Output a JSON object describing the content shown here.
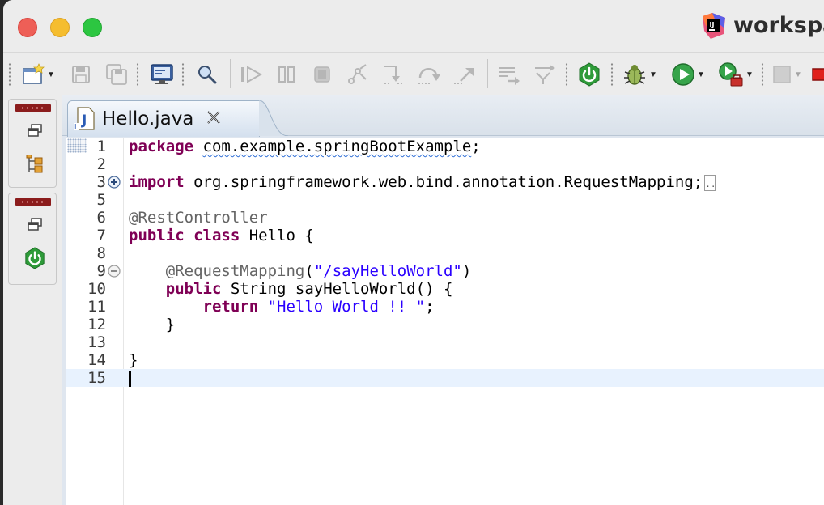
{
  "window": {
    "app_title": "workspace",
    "controls": [
      "close",
      "minimize",
      "zoom"
    ]
  },
  "toolbar": {
    "items": [
      {
        "name": "new-wizard",
        "icon": "new-wizard-icon",
        "dropdown": true
      },
      {
        "name": "save",
        "icon": "save-icon",
        "enabled": false
      },
      {
        "name": "save-all",
        "icon": "save-all-icon",
        "enabled": false
      },
      {
        "name": "open-console",
        "icon": "monitor-icon"
      },
      {
        "name": "search",
        "icon": "search-icon"
      },
      {
        "name": "resume",
        "icon": "resume-icon",
        "enabled": false
      },
      {
        "name": "suspend",
        "icon": "suspend-icon",
        "enabled": false
      },
      {
        "name": "terminate",
        "icon": "terminate-icon",
        "enabled": false
      },
      {
        "name": "disconnect",
        "icon": "disconnect-icon",
        "enabled": false
      },
      {
        "name": "step-into",
        "icon": "step-into-icon",
        "enabled": false
      },
      {
        "name": "step-over",
        "icon": "step-over-icon",
        "enabled": false
      },
      {
        "name": "step-return",
        "icon": "step-return-icon",
        "enabled": false
      },
      {
        "name": "drop-to-frame",
        "icon": "drop-to-frame-icon",
        "enabled": false
      },
      {
        "name": "use-step-filters",
        "icon": "step-filters-icon",
        "enabled": false
      },
      {
        "name": "spring-boot-dashboard",
        "icon": "spring-power-icon"
      },
      {
        "name": "debug",
        "icon": "bug-icon",
        "dropdown": true
      },
      {
        "name": "run",
        "icon": "run-icon",
        "dropdown": true
      },
      {
        "name": "run-external-tools",
        "icon": "external-tools-icon",
        "dropdown": true
      },
      {
        "name": "coverage",
        "icon": "coverage-icon",
        "dropdown": true,
        "enabled": false
      }
    ]
  },
  "editor": {
    "tab_label": "Hello.java",
    "file_icon": "java-file-icon",
    "lines": [
      {
        "n": "1",
        "tokens": [
          {
            "t": "package",
            "c": "kw"
          },
          {
            "t": " "
          },
          {
            "t": "com.example.springBootExample",
            "c": "squiggle"
          },
          {
            "t": ";"
          }
        ]
      },
      {
        "n": "2",
        "tokens": []
      },
      {
        "n": "3",
        "fold": "expand",
        "tokens": [
          {
            "t": "import",
            "c": "kw"
          },
          {
            "t": " org.springframework.web.bind.annotation.RequestMapping;"
          }
        ],
        "folded": true
      },
      {
        "n": "5",
        "tokens": []
      },
      {
        "n": "6",
        "tokens": [
          {
            "t": "@RestController",
            "c": "an"
          }
        ]
      },
      {
        "n": "7",
        "tokens": [
          {
            "t": "public",
            "c": "kw"
          },
          {
            "t": " "
          },
          {
            "t": "class",
            "c": "kw"
          },
          {
            "t": " Hello {"
          }
        ]
      },
      {
        "n": "8",
        "tokens": []
      },
      {
        "n": "9",
        "fold": "collapse",
        "tokens": [
          {
            "t": "    "
          },
          {
            "t": "@RequestMapping",
            "c": "an"
          },
          {
            "t": "("
          },
          {
            "t": "\"/sayHelloWorld\"",
            "c": "str"
          },
          {
            "t": ")"
          }
        ]
      },
      {
        "n": "10",
        "tokens": [
          {
            "t": "    "
          },
          {
            "t": "public",
            "c": "kw"
          },
          {
            "t": " String sayHelloWorld() {"
          }
        ]
      },
      {
        "n": "11",
        "tokens": [
          {
            "t": "        "
          },
          {
            "t": "return",
            "c": "kw"
          },
          {
            "t": " "
          },
          {
            "t": "\"Hello World !! \"",
            "c": "str"
          },
          {
            "t": ";"
          }
        ]
      },
      {
        "n": "12",
        "tokens": [
          {
            "t": "    }"
          }
        ]
      },
      {
        "n": "13",
        "tokens": []
      },
      {
        "n": "14",
        "tokens": [
          {
            "t": "}"
          }
        ]
      },
      {
        "n": "15",
        "tokens": [],
        "current": true,
        "cursor": true
      }
    ]
  },
  "colors": {
    "keyword": "#7f0055",
    "annotation": "#646464",
    "string": "#2a00ff",
    "current_line": "#e8f2fe"
  }
}
